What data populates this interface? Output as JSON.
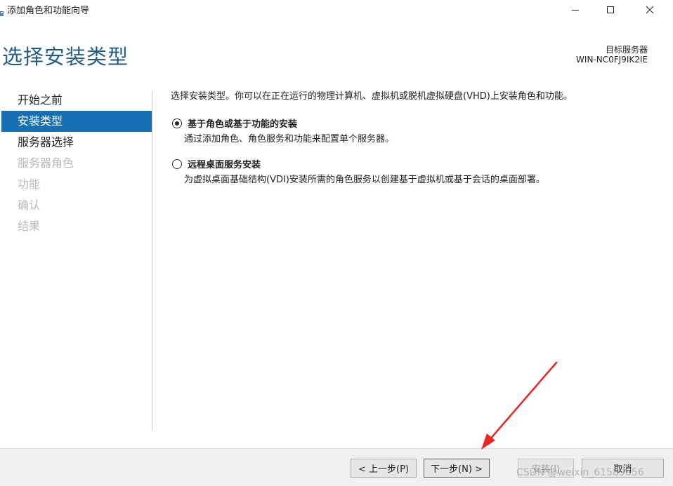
{
  "window": {
    "title": "添加角色和功能向导",
    "minimize_label": "minimize",
    "maximize_label": "maximize",
    "close_label": "close"
  },
  "header": {
    "page_title": "选择安装类型",
    "target_label": "目标服务器",
    "target_name": "WIN-NC0FJ9IK2IE"
  },
  "sidebar": {
    "items": [
      {
        "label": "开始之前",
        "state": "normal"
      },
      {
        "label": "安装类型",
        "state": "active"
      },
      {
        "label": "服务器选择",
        "state": "normal"
      },
      {
        "label": "服务器角色",
        "state": "disabled"
      },
      {
        "label": "功能",
        "state": "disabled"
      },
      {
        "label": "确认",
        "state": "disabled"
      },
      {
        "label": "结果",
        "state": "disabled"
      }
    ]
  },
  "main": {
    "intro": "选择安装类型。你可以在正在运行的物理计算机、虚拟机或脱机虚拟硬盘(VHD)上安装角色和功能。",
    "options": [
      {
        "title": "基于角色或基于功能的安装",
        "description": "通过添加角色、角色服务和功能来配置单个服务器。",
        "selected": true
      },
      {
        "title": "远程桌面服务安装",
        "description": "为虚拟桌面基础结构(VDI)安装所需的角色服务以创建基于虚拟机或基于会话的桌面部署。",
        "selected": false
      }
    ]
  },
  "footer": {
    "prev_label": "< 上一步(P)",
    "next_label": "下一步(N) >",
    "install_label": "安装(I)",
    "cancel_label": "取消"
  },
  "watermark": "CSDN @weixin_61589656",
  "colors": {
    "accent": "#1870b4",
    "title_blue": "#1f5c8c",
    "annotation_arrow": "#e8271f"
  }
}
